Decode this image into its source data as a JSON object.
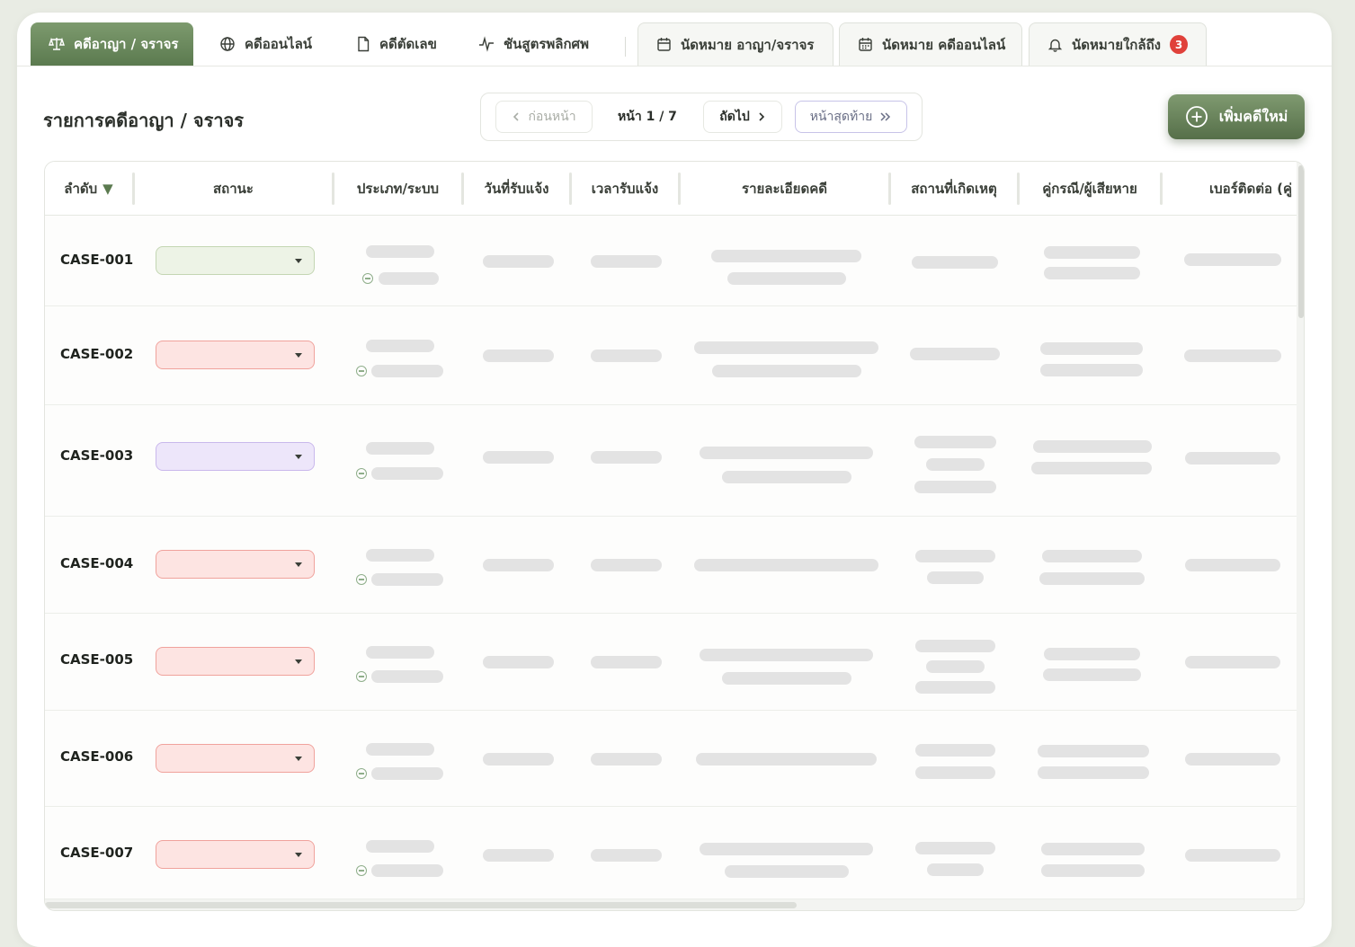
{
  "tabs": [
    {
      "label": "คดีอาญา / จราจร",
      "icon": "scale-icon"
    },
    {
      "label": "คดีออนไลน์",
      "icon": "globe-icon"
    },
    {
      "label": "คดีตัดเลข",
      "icon": "document-icon"
    },
    {
      "label": "ชันสูตรพลิกศพ",
      "icon": "pulse-icon"
    },
    {
      "label": "นัดหมาย อาญา/จราจร",
      "icon": "calendar-icon"
    },
    {
      "label": "นัดหมาย คดีออนไลน์",
      "icon": "calendar-grid-icon"
    },
    {
      "label": "นัดหมายใกล้ถึง",
      "icon": "bell-icon",
      "badge": "3"
    }
  ],
  "page_title": "รายการคดีอาญา / จราจร",
  "pagination": {
    "prev_label": "ก่อนหน้า",
    "info": "หน้า 1 / 7",
    "next_label": "ถัดไป",
    "last_label": "หน้าสุดท้าย"
  },
  "add_button_label": "เพิ่มคดีใหม่",
  "table": {
    "columns": [
      "ลำดับ",
      "สถานะ",
      "ประเภท/ระบบ",
      "วันที่รับแจ้ง",
      "เวลารับแจ้ง",
      "รายละเอียดคดี",
      "สถานที่เกิดเหตุ",
      "คู่กรณี/ผู้เสียหาย",
      "เบอร์ติดต่อ (คู่"
    ],
    "sort_indicator": "▼",
    "rows": [
      {
        "id": "CASE-001",
        "status_color": "green"
      },
      {
        "id": "CASE-002",
        "status_color": "red"
      },
      {
        "id": "CASE-003",
        "status_color": "purple"
      },
      {
        "id": "CASE-004",
        "status_color": "red"
      },
      {
        "id": "CASE-005",
        "status_color": "red"
      },
      {
        "id": "CASE-006",
        "status_color": "red"
      },
      {
        "id": "CASE-007",
        "status_color": "red"
      }
    ]
  },
  "colors": {
    "brand_green": "#5b7a4f",
    "status_green": "#edf3e6",
    "status_red": "#fde4e2",
    "status_purple": "#ede6fa",
    "badge_red": "#e0413a"
  }
}
